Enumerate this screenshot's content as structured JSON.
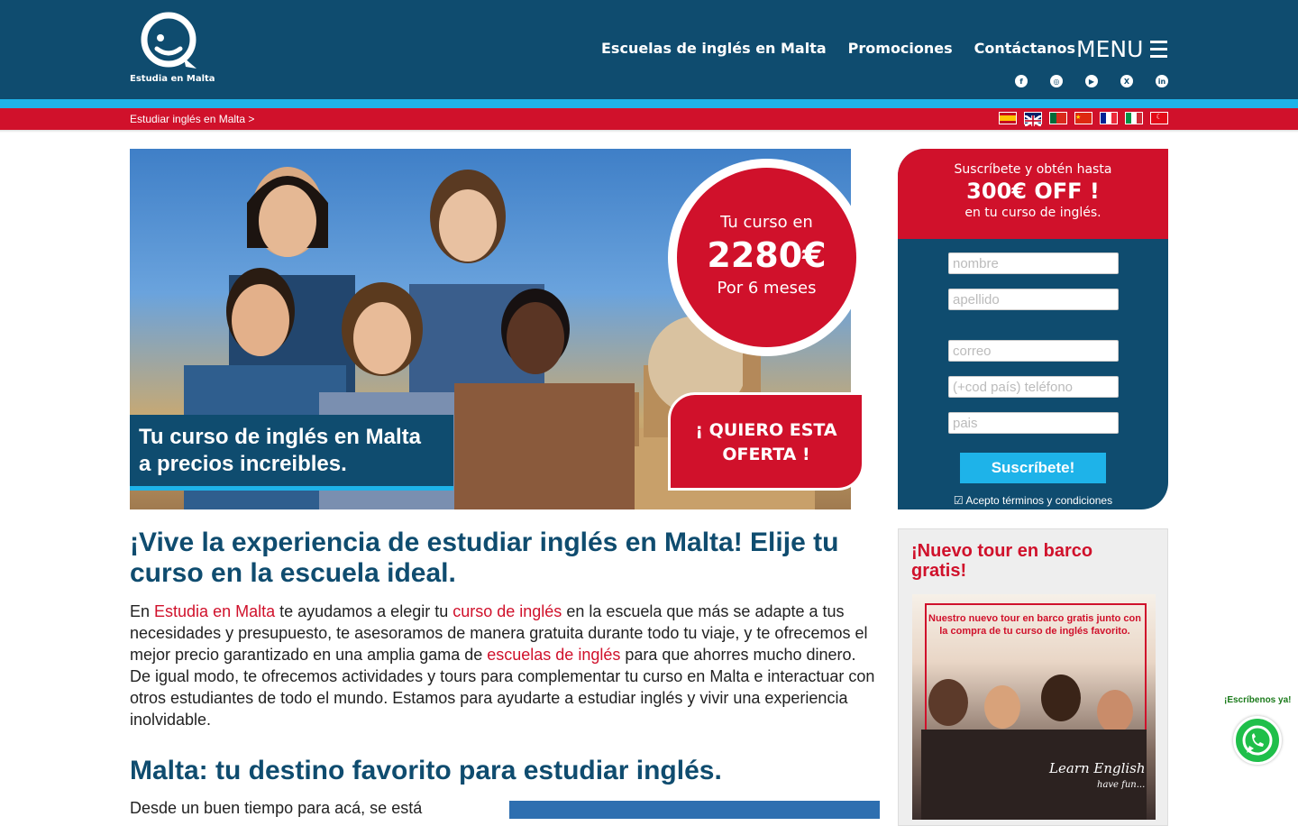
{
  "brand": {
    "name": "Estudia en Malta"
  },
  "nav": [
    {
      "label": "Escuelas de inglés en Malta"
    },
    {
      "label": "Promociones"
    },
    {
      "label": "Contáctanos"
    }
  ],
  "menu": {
    "label": "MENU"
  },
  "social": [
    "facebook-icon",
    "instagram-icon",
    "youtube-icon",
    "x-icon",
    "linkedin-icon"
  ],
  "breadcrumb": {
    "text": "Estudiar inglés en Malta >"
  },
  "languages": [
    "es",
    "en",
    "pt",
    "zh",
    "fr",
    "it",
    "tr"
  ],
  "hero": {
    "caption_line1": "Tu curso de inglés en Malta",
    "caption_line2": "a precios increibles.",
    "price_prefix": "Tu curso en",
    "price": "2280€",
    "price_duration": "Por 6 meses",
    "cta_line1": "¡ QUIERO ESTA",
    "cta_line2": "OFERTA !"
  },
  "main": {
    "heading": "¡Vive la experiencia de estudiar inglés en Malta! Elije tu curso en la escuela ideal.",
    "p_intro": "En ",
    "link1": "Estudia en Malta",
    "p_part2": " te ayudamos a elegir tu ",
    "link2": "curso de inglés",
    "p_part3": " en la escuela que más se adapte a tus necesidades y presupuesto, te asesoramos de manera gratuita durante todo tu viaje, y te ofrecemos el mejor precio garantizado en una amplia gama de ",
    "link3": "escuelas de inglés",
    "p_part4": " para que ahorres mucho dinero. De igual modo, te ofrecemos actividades y tours para complementar tu curso en Malta e interactuar con otros estudiantes de todo el mundo. Estamos para ayudarte a estudiar inglés y vivir una experiencia inolvidable.",
    "heading2": "Malta: tu destino favorito para estudiar inglés.",
    "p2_start": "Desde un buen tiempo para acá, se está"
  },
  "form": {
    "head1": "Suscríbete y obtén hasta",
    "head2": "300€ OFF !",
    "head3": "en tu curso de inglés.",
    "placeholder_name": "nombre",
    "placeholder_last": "apellido",
    "placeholder_email": "correo",
    "placeholder_phone": "(+cod país) teléfono",
    "placeholder_country": "pais",
    "submit": "Suscríbete!",
    "terms": "☑ Acepto términos y condiciones"
  },
  "promo": {
    "title": "¡Nuevo tour en barco gratis!",
    "image_text": "Nuestro nuevo tour en barco gratis junto con la compra de tu curso de inglés favorito.",
    "learn": "Learn English",
    "fun": "have fun..."
  },
  "whatsapp": {
    "label": "¡Escríbenos ya!"
  },
  "colors": {
    "navy": "#0f4c6f",
    "red": "#d0112b",
    "cyan": "#1eb3e9",
    "whatsapp": "#1fbf4a"
  }
}
